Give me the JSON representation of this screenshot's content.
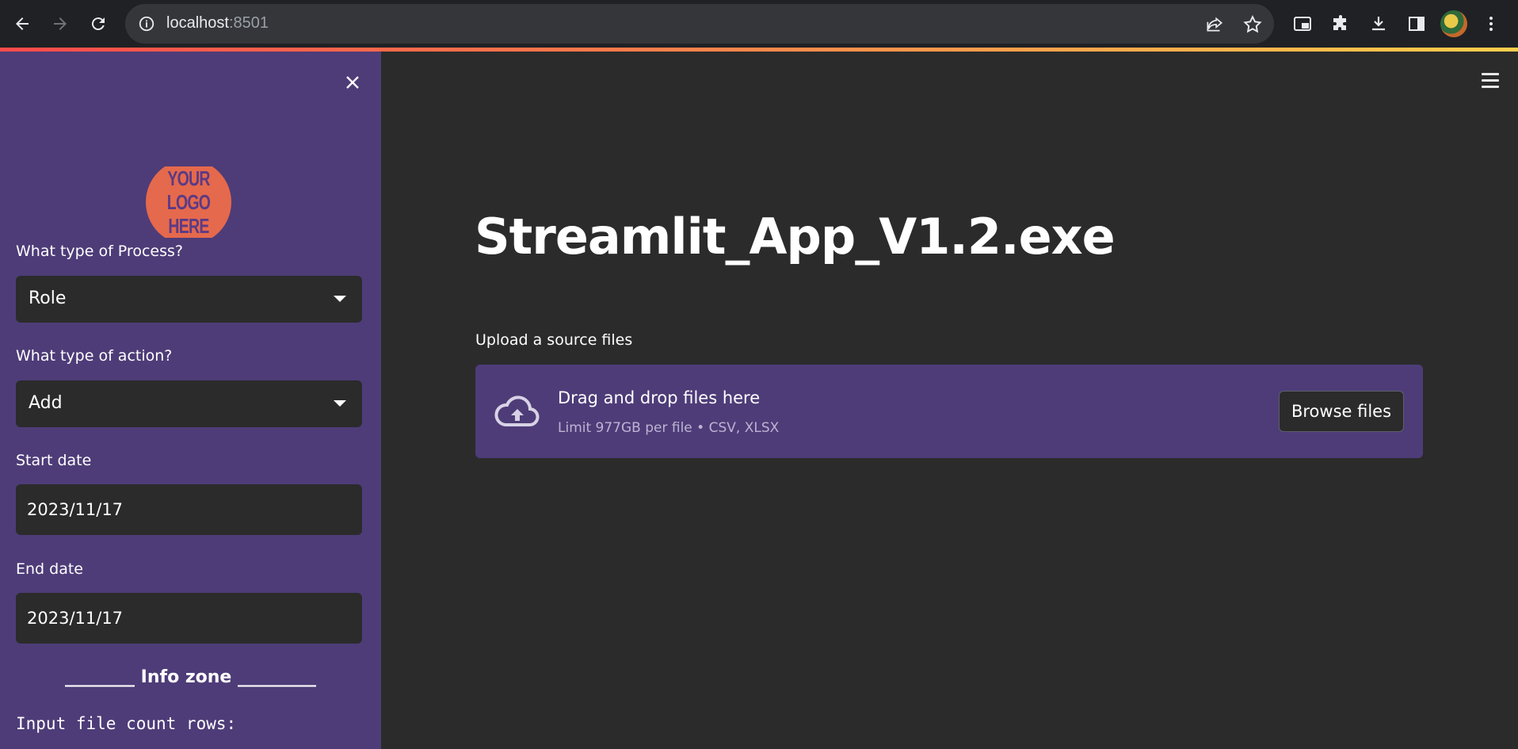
{
  "browser": {
    "url_host": "localhost",
    "url_port": ":8501"
  },
  "sidebar": {
    "logo_text": "YOUR LOGO HERE",
    "process_label": "What type of Process?",
    "process_value": "Role",
    "action_label": "What type of action?",
    "action_value": "Add",
    "start_label": "Start date",
    "start_value": "2023/11/17",
    "end_label": "End date",
    "end_value": "2023/11/17",
    "info_zone": "________ Info zone _________",
    "count_rows": "Input file count rows:"
  },
  "main": {
    "title": "Streamlit_App_V1.2.exe",
    "upload_label": "Upload a source files",
    "dropzone_title": "Drag and drop files here",
    "dropzone_sub": "Limit 977GB per file • CSV, XLSX",
    "browse_label": "Browse files"
  },
  "colors": {
    "sidebar_bg": "#4e3c78",
    "main_bg": "#2b2b2b",
    "logo_orange": "#e5694c"
  }
}
